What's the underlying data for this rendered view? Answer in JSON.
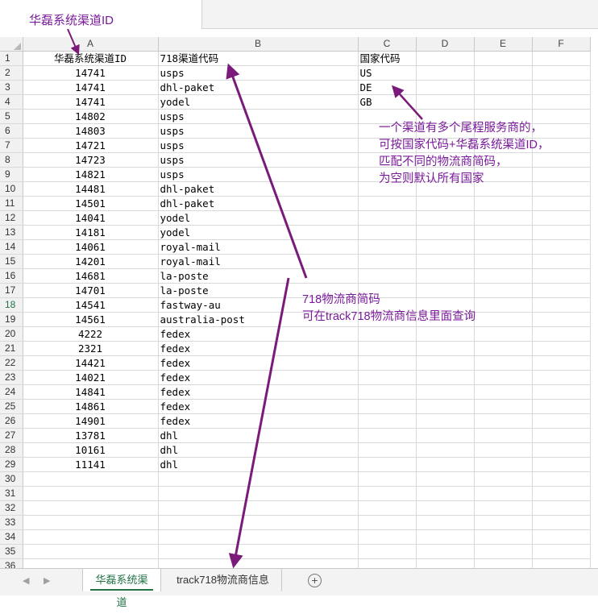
{
  "columns": [
    "A",
    "B",
    "C",
    "D",
    "E",
    "F"
  ],
  "headers": {
    "a": "华磊系统渠道ID",
    "b": "718渠道代码",
    "c": "国家代码"
  },
  "rows": [
    {
      "a": "14741",
      "b": "usps",
      "c": "US"
    },
    {
      "a": "14741",
      "b": "dhl-paket",
      "c": "DE"
    },
    {
      "a": "14741",
      "b": "yodel",
      "c": "GB"
    },
    {
      "a": "14802",
      "b": "usps",
      "c": ""
    },
    {
      "a": "14803",
      "b": "usps",
      "c": ""
    },
    {
      "a": "14721",
      "b": "usps",
      "c": ""
    },
    {
      "a": "14723",
      "b": "usps",
      "c": ""
    },
    {
      "a": "14821",
      "b": "usps",
      "c": ""
    },
    {
      "a": "14481",
      "b": "dhl-paket",
      "c": ""
    },
    {
      "a": "14501",
      "b": "dhl-paket",
      "c": ""
    },
    {
      "a": "14041",
      "b": "yodel",
      "c": ""
    },
    {
      "a": "14181",
      "b": "yodel",
      "c": ""
    },
    {
      "a": "14061",
      "b": "royal-mail",
      "c": ""
    },
    {
      "a": "14201",
      "b": "royal-mail",
      "c": ""
    },
    {
      "a": "14681",
      "b": "la-poste",
      "c": ""
    },
    {
      "a": "14701",
      "b": "la-poste",
      "c": ""
    },
    {
      "a": "14541",
      "b": "fastway-au",
      "c": ""
    },
    {
      "a": "14561",
      "b": "australia-post",
      "c": ""
    },
    {
      "a": "4222",
      "b": "fedex",
      "c": ""
    },
    {
      "a": "2321",
      "b": "fedex",
      "c": ""
    },
    {
      "a": "14421",
      "b": "fedex",
      "c": ""
    },
    {
      "a": "14021",
      "b": "fedex",
      "c": ""
    },
    {
      "a": "14841",
      "b": "fedex",
      "c": ""
    },
    {
      "a": "14861",
      "b": "fedex",
      "c": ""
    },
    {
      "a": "14901",
      "b": "fedex",
      "c": ""
    },
    {
      "a": "13781",
      "b": "dhl",
      "c": ""
    },
    {
      "a": "10161",
      "b": "dhl",
      "c": ""
    },
    {
      "a": "11141",
      "b": "dhl",
      "c": ""
    }
  ],
  "row_numbers": [
    "1",
    "2",
    "3",
    "4",
    "5",
    "6",
    "7",
    "8",
    "9",
    "10",
    "11",
    "12",
    "13",
    "14",
    "15",
    "16",
    "17",
    "18",
    "19",
    "20",
    "21",
    "22",
    "23",
    "24",
    "25",
    "26",
    "27",
    "28",
    "29",
    "30",
    "31",
    "32",
    "33",
    "34",
    "35",
    "36"
  ],
  "annotations": {
    "top_label": "华磊系统渠道ID",
    "country_note": [
      "一个渠道有多个尾程服务商的，",
      "可按国家代码+华磊系统渠道ID，",
      "匹配不同的物流商简码，",
      "为空则默认所有国家"
    ],
    "code_note": [
      "718物流商简码",
      "可在track718物流商信息里面查询"
    ]
  },
  "sheet_tabs": [
    "华磊系统渠道",
    "track718物流商信息"
  ],
  "selected_row": "18",
  "colors": {
    "annotation": "#7a1a9a",
    "arrow": "#7a1a7a",
    "active_tab": "#217346"
  }
}
